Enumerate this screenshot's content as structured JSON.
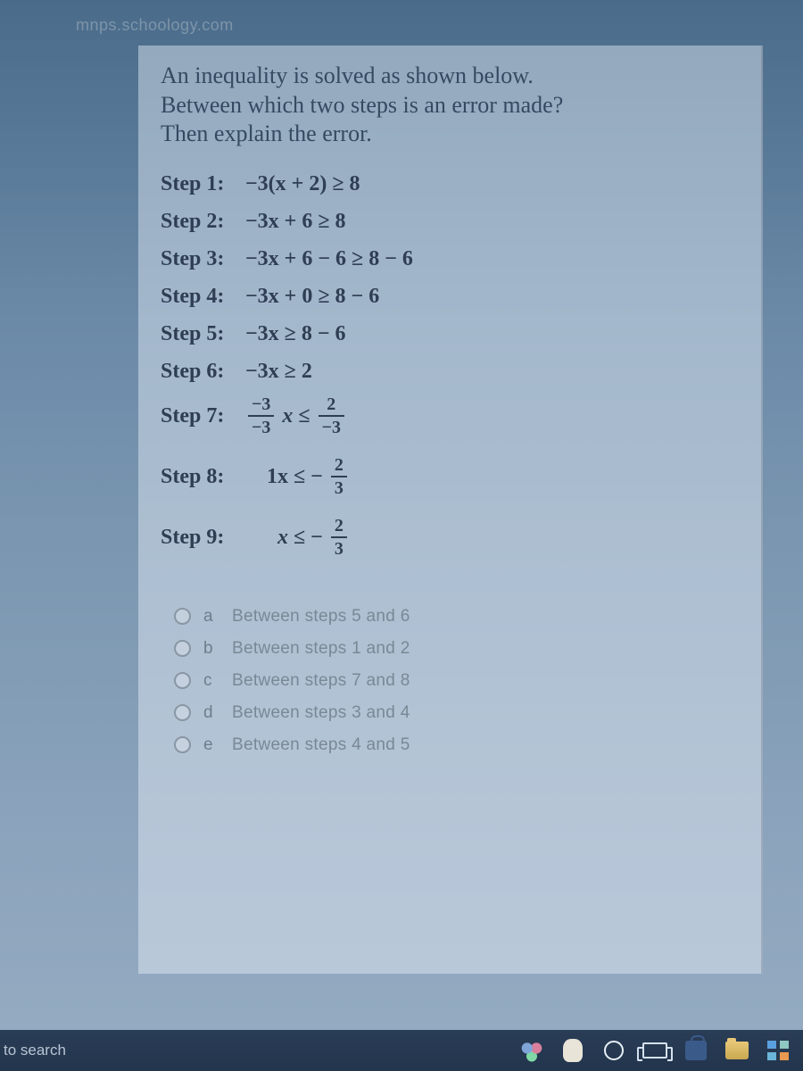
{
  "url": "mnps.schoology.com",
  "prompt": {
    "line1": "An inequality is solved as shown below.",
    "line2": "Between which two steps is an error made?",
    "line3": "Then explain the error."
  },
  "steps": {
    "s1": {
      "label": "Step 1:",
      "expr": "−3(x + 2) ≥ 8"
    },
    "s2": {
      "label": "Step 2:",
      "expr": "−3x + 6 ≥ 8"
    },
    "s3": {
      "label": "Step 3:",
      "expr": "−3x + 6 − 6 ≥ 8 − 6"
    },
    "s4": {
      "label": "Step 4:",
      "expr": "−3x + 0 ≥ 8 − 6"
    },
    "s5": {
      "label": "Step 5:",
      "expr": "−3x ≥ 8 − 6"
    },
    "s6": {
      "label": "Step 6:",
      "expr": "−3x ≥ 2"
    },
    "s7": {
      "label": "Step 7:",
      "lnum": "−3",
      "lden": "−3",
      "lvar": "x",
      "rel": "≤",
      "rnum": "2",
      "rden": "−3"
    },
    "s8": {
      "label": "Step 8:",
      "left": "1x",
      "rel": "≤",
      "sign": "−",
      "rnum": "2",
      "rden": "3"
    },
    "s9": {
      "label": "Step 9:",
      "left": "x",
      "rel": "≤",
      "sign": "−",
      "rnum": "2",
      "rden": "3"
    }
  },
  "options": {
    "a": {
      "letter": "a",
      "text": "Between steps 5 and 6"
    },
    "b": {
      "letter": "b",
      "text": "Between steps 1 and 2"
    },
    "c": {
      "letter": "c",
      "text": "Between steps 7 and 8"
    },
    "d": {
      "letter": "d",
      "text": "Between steps 3 and 4"
    },
    "e": {
      "letter": "e",
      "text": "Between steps 4 and 5"
    }
  },
  "taskbar": {
    "search": "to search"
  }
}
